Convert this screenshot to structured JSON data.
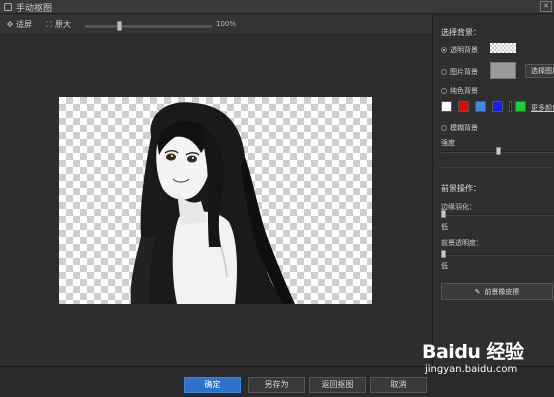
{
  "window": {
    "title": "手动抠图",
    "close_icon": "close-icon"
  },
  "toolbar": {
    "fit_label": "适屏",
    "original_label": "原大",
    "zoom_percent": "100%",
    "zoom_level": 0.27
  },
  "right_panel": {
    "bg_heading": "选择背景：",
    "opt_transparent": "透明背景",
    "opt_image": "图片背景",
    "choose_image_btn": "选择图片",
    "opt_solid": "纯色背景",
    "colors": [
      "#ffffff",
      "#ee0000",
      "#3f88e0",
      "#1a1aee",
      "#111111",
      "#19d030"
    ],
    "more_colors": "更多颜色",
    "opt_blur": "模糊背景",
    "strength_label": "强度",
    "strength_level": 0.5,
    "fg_heading": "前景操作：",
    "feather_label": "边缘羽化：",
    "feather_low": "低",
    "opacity_label": "前景透明度：",
    "opacity_low": "低",
    "eraser_btn": "前景橡皮擦"
  },
  "bottom": {
    "confirm": "确定",
    "save_as": "另存为",
    "back": "返回抠图",
    "cancel": "取消"
  },
  "watermark": {
    "logo": "Baidu 经验",
    "url": "jingyan.baidu.com"
  },
  "colors": {
    "accent": "#2f73c9",
    "panel": "#2f2f2f",
    "canvas": "#2e2e2e"
  }
}
